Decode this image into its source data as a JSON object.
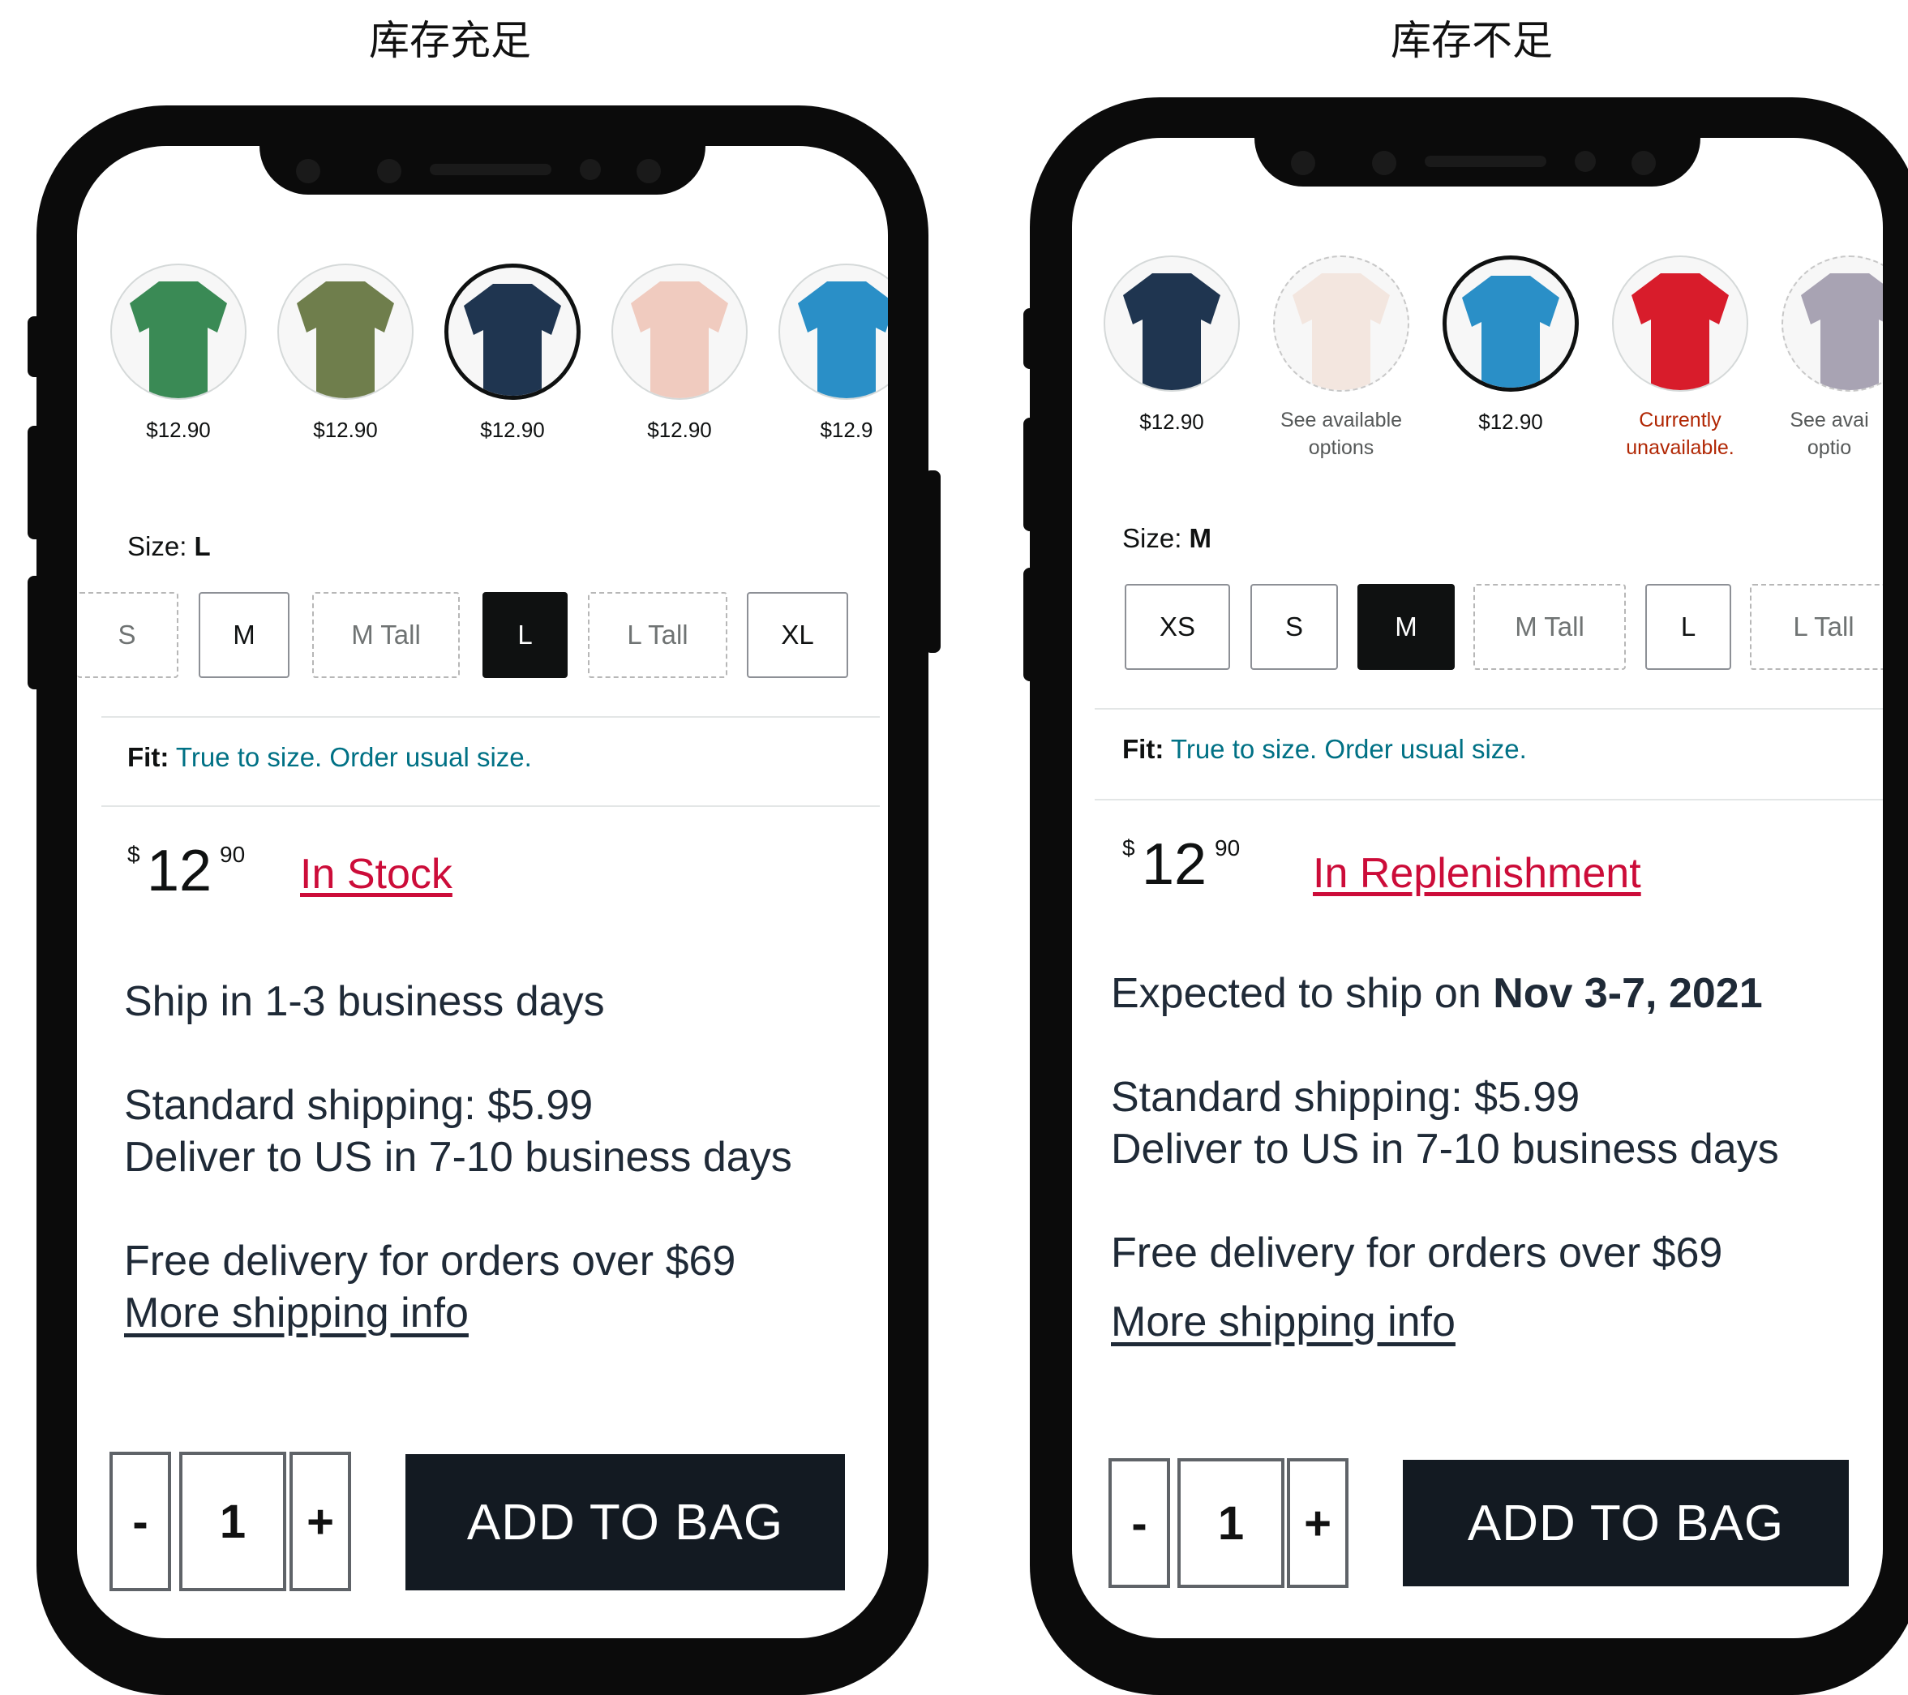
{
  "captions": {
    "left": "库存充足",
    "right": "库存不足"
  },
  "left": {
    "swatches": [
      {
        "color": "#3a8a55",
        "price": "$12.90",
        "note": "",
        "selected": false,
        "dashed": false
      },
      {
        "color": "#6f7e4c",
        "price": "$12.90",
        "note": "",
        "selected": false,
        "dashed": false
      },
      {
        "color": "#1f3550",
        "price": "$12.90",
        "note": "",
        "selected": true,
        "dashed": false
      },
      {
        "color": "#f0cbbf",
        "price": "$12.90",
        "note": "",
        "selected": false,
        "dashed": false
      },
      {
        "color": "#2a8fc7",
        "price": "$12.9",
        "note": "",
        "selected": false,
        "dashed": false
      }
    ],
    "size_label": "Size:",
    "size_value": "L",
    "sizes": [
      {
        "label": "S",
        "state": "unavailable"
      },
      {
        "label": "M",
        "state": "available"
      },
      {
        "label": "M Tall",
        "state": "unavailable"
      },
      {
        "label": "L",
        "state": "selected"
      },
      {
        "label": "L Tall",
        "state": "unavailable"
      },
      {
        "label": "XL",
        "state": "available"
      }
    ],
    "fit_label": "Fit:",
    "fit_text": "True to size. Order usual size.",
    "price_symbol": "$",
    "price_whole": "12",
    "price_fraction": "90",
    "stock_status": "In Stock",
    "ship_line": "Ship in 1-3 business days",
    "shipping_standard": "Standard shipping: $5.99",
    "shipping_deliver": "Deliver to US in 7-10 business days",
    "free_delivery": "Free delivery for orders over $69",
    "more_shipping": "More shipping info",
    "qty_minus": "-",
    "qty_value": "1",
    "qty_plus": "+",
    "add_to_bag": "ADD TO BAG"
  },
  "right": {
    "swatches": [
      {
        "color": "#1f3550",
        "price": "$12.90",
        "note": "",
        "selected": false,
        "dashed": false
      },
      {
        "color": "#f3e6df",
        "price": "",
        "note": "See available options",
        "selected": false,
        "dashed": true
      },
      {
        "color": "#2a8fc7",
        "price": "$12.90",
        "note": "",
        "selected": true,
        "dashed": false
      },
      {
        "color": "#d81c2b",
        "price": "",
        "note": "Currently unavailable.",
        "selected": false,
        "dashed": false
      },
      {
        "color": "#a8a3b3",
        "price": "",
        "note": "See avai optio",
        "selected": false,
        "dashed": true
      }
    ],
    "size_label": "Size:",
    "size_value": "M",
    "sizes": [
      {
        "label": "XS",
        "state": "available"
      },
      {
        "label": "S",
        "state": "available"
      },
      {
        "label": "M",
        "state": "selected"
      },
      {
        "label": "M Tall",
        "state": "unavailable"
      },
      {
        "label": "L",
        "state": "available"
      },
      {
        "label": "L Tall",
        "state": "unavailable"
      }
    ],
    "fit_label": "Fit:",
    "fit_text": "True to size. Order usual size.",
    "price_symbol": "$",
    "price_whole": "12",
    "price_fraction": "90",
    "stock_status": "In Replenishment",
    "ship_prefix": "Expected to ship on ",
    "ship_date": "Nov 3-7, 2021",
    "shipping_standard": "Standard shipping: $5.99",
    "shipping_deliver": "Deliver to US in 7-10 business days",
    "free_delivery": "Free delivery for orders over $69",
    "more_shipping": "More shipping info",
    "qty_minus": "-",
    "qty_value": "1",
    "qty_plus": "+",
    "add_to_bag": "ADD TO BAG"
  }
}
